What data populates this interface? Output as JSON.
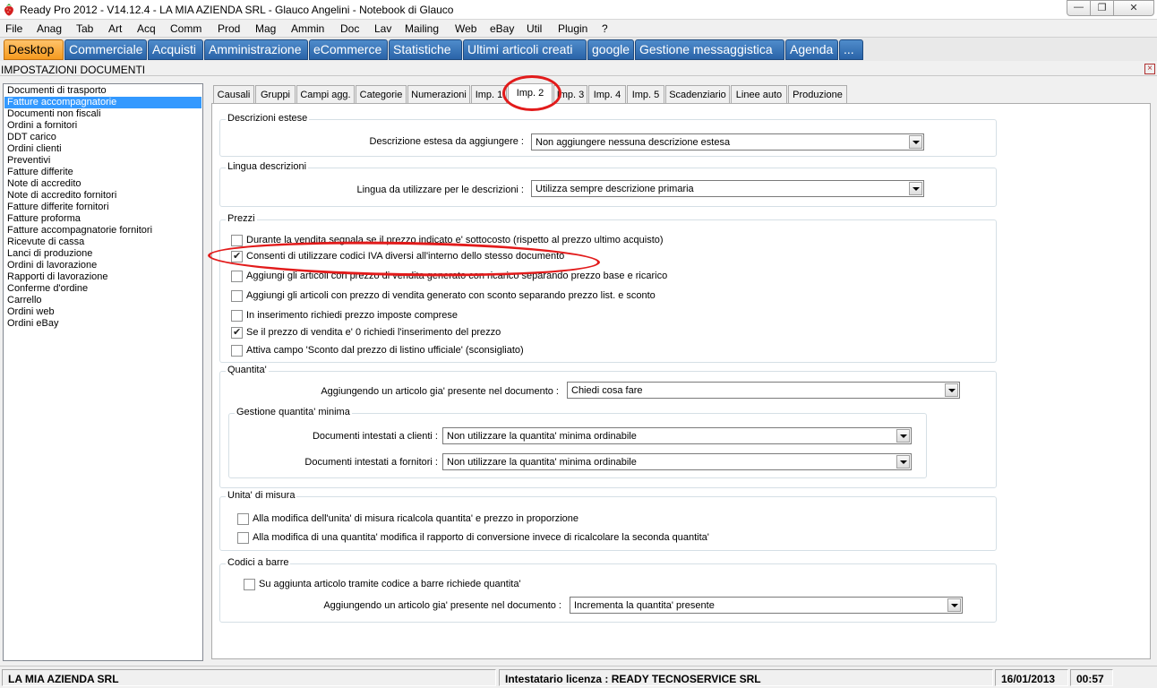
{
  "window": {
    "title": "Ready Pro 2012 - V14.12.4 - LA MIA AZIENDA SRL - Glauco Angelini - Notebook di Glauco",
    "min_glyph": "—",
    "max_glyph": "❐",
    "close_glyph": "✕"
  },
  "menu": [
    "File",
    "Anag",
    "Tab",
    "Art",
    "Acq",
    "Comm",
    "Prod",
    "Mag",
    "Ammin",
    "Doc",
    "Lav",
    "Mailing",
    "Web",
    "eBay",
    "Util",
    "Plugin",
    "?"
  ],
  "main_tabs": [
    "Desktop",
    "Commerciale",
    "Acquisti",
    "Amministrazione",
    "eCommerce",
    "Statistiche",
    "Ultimi articoli creati",
    "google",
    "Gestione messaggistica",
    "Agenda",
    "..."
  ],
  "panel": {
    "title": "IMPOSTAZIONI DOCUMENTI",
    "close_glyph": "×"
  },
  "doc_list": [
    "Documenti di trasporto",
    "Fatture accompagnatorie",
    "Documenti non fiscali",
    "Ordini a fornitori",
    "DDT carico",
    "Ordini clienti",
    "Preventivi",
    "Fatture differite",
    "Note di accredito",
    "Note di accredito fornitori",
    "Fatture differite fornitori",
    "Fatture proforma",
    "Fatture accompagnatorie fornitori",
    "Ricevute di cassa",
    "Lanci di produzione",
    "Ordini di lavorazione",
    "Rapporti di lavorazione",
    "Conferme d'ordine",
    "Carrello",
    "Ordini web",
    "Ordini eBay"
  ],
  "sub_tabs": [
    "Causali",
    "Gruppi",
    "Campi agg.",
    "Categorie",
    "Numerazioni",
    "Imp. 1",
    "Imp. 2",
    "Imp. 3",
    "Imp. 4",
    "Imp. 5",
    "Scadenziario",
    "Linee auto",
    "Produzione"
  ],
  "descrizioni": {
    "title": "Descrizioni estese",
    "label": "Descrizione estesa da aggiungere :",
    "value": "Non aggiungere nessuna descrizione estesa"
  },
  "lingua": {
    "title": "Lingua descrizioni",
    "label": "Lingua da utilizzare per le descrizioni :",
    "value": "Utilizza sempre descrizione primaria"
  },
  "prezzi": {
    "title": "Prezzi",
    "options": [
      {
        "label": "Durante la vendita segnala se il prezzo indicato e' sottocosto (rispetto al prezzo ultimo acquisto)",
        "checked": false
      },
      {
        "label": "Consenti di utilizzare codici IVA diversi all'interno dello stesso documento",
        "checked": true
      },
      {
        "label": "Aggiungi gli articoli con prezzo di vendita generato con ricarico separando prezzo base e ricarico",
        "checked": false
      },
      {
        "label": "Aggiungi gli articoli con prezzo di vendita generato con sconto separando prezzo list. e sconto",
        "checked": false
      },
      {
        "label": "In inserimento richiedi prezzo imposte comprese",
        "checked": false
      },
      {
        "label": "Se il prezzo di vendita e' 0 richiedi l'inserimento del prezzo",
        "checked": true
      },
      {
        "label": "Attiva campo 'Sconto dal prezzo di listino ufficiale' (sconsigliato)",
        "checked": false
      }
    ]
  },
  "quantita": {
    "title": "Quantita'",
    "label": "Aggiungendo un articolo gia' presente nel documento :",
    "value": "Chiedi cosa fare",
    "minima": {
      "title": "Gestione quantita' minima",
      "clienti_label": "Documenti intestati a clienti :",
      "clienti_value": "Non utilizzare la quantita' minima ordinabile",
      "fornitori_label": "Documenti intestati a fornitori :",
      "fornitori_value": "Non utilizzare la quantita' minima ordinabile"
    }
  },
  "unita": {
    "title": "Unita' di misura",
    "options": [
      {
        "label": "Alla modifica dell'unita' di misura ricalcola quantita' e prezzo in proporzione",
        "checked": false
      },
      {
        "label": "Alla modifica di una quantita' modifica il rapporto di conversione invece di ricalcolare la seconda quantita'",
        "checked": false
      }
    ]
  },
  "barre": {
    "title": "Codici a barre",
    "option": {
      "label": "Su aggiunta articolo tramite codice a barre richiede quantita'",
      "checked": false
    },
    "label": "Aggiungendo un articolo gia' presente nel documento :",
    "value": "Incrementa la quantita' presente"
  },
  "status": {
    "company": "LA MIA AZIENDA SRL",
    "license": "Intestatario licenza : READY TECNOSERVICE SRL",
    "date": "16/01/2013",
    "time": "00:57"
  },
  "colors": {
    "tab_blue": "#2a63a8",
    "tab_active": "#f59a1f",
    "selection": "#3399ff",
    "annotation": "#e21b1b"
  }
}
